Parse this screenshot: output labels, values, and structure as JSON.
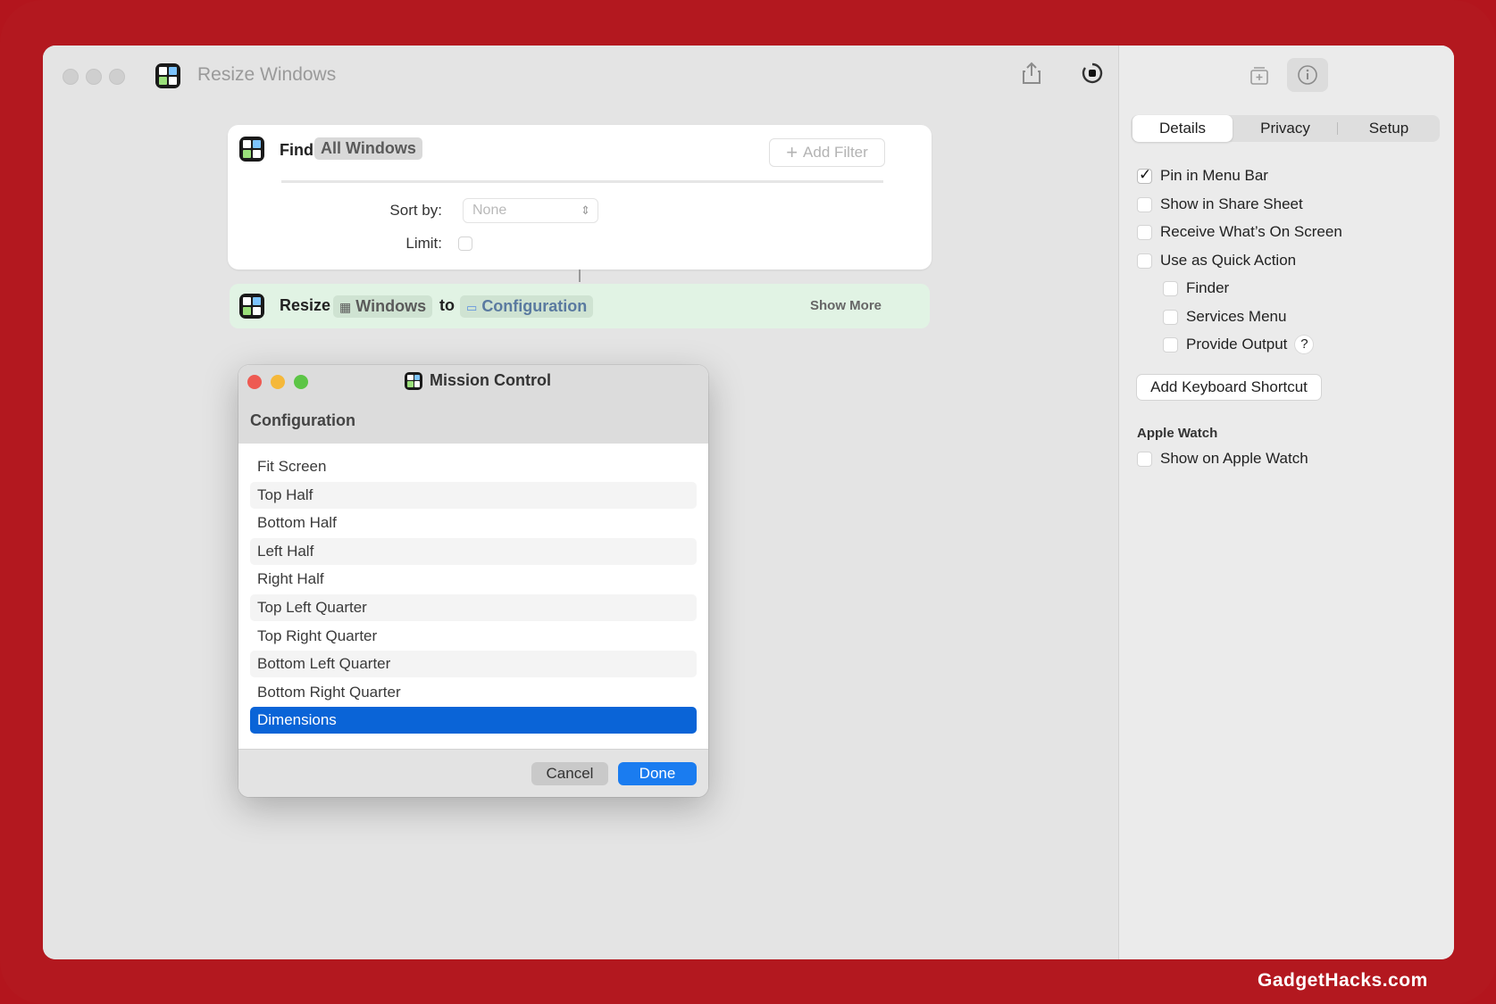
{
  "window": {
    "title": "Resize Windows"
  },
  "find_action": {
    "label": "Find",
    "token": "All Windows",
    "add_filter": "Add Filter",
    "sort_by_label": "Sort by:",
    "sort_by_value": "None",
    "limit_label": "Limit:"
  },
  "resize_action": {
    "label": "Resize",
    "windows_token": "Windows",
    "to_label": "to",
    "config_token": "Configuration",
    "show_more": "Show More"
  },
  "dialog": {
    "title": "Mission Control",
    "subtitle": "Configuration",
    "items": [
      {
        "label": "Fit Screen"
      },
      {
        "label": "Top Half"
      },
      {
        "label": "Bottom Half"
      },
      {
        "label": "Left Half"
      },
      {
        "label": "Right Half"
      },
      {
        "label": "Top Left Quarter"
      },
      {
        "label": "Top Right Quarter"
      },
      {
        "label": "Bottom Left Quarter"
      },
      {
        "label": "Bottom Right Quarter"
      },
      {
        "label": "Dimensions"
      }
    ],
    "selected": "Dimensions",
    "cancel": "Cancel",
    "done": "Done"
  },
  "sidebar": {
    "tabs": [
      "Details",
      "Privacy",
      "Setup"
    ],
    "active_tab": "Details",
    "options": [
      {
        "label": "Pin in Menu Bar",
        "checked": true
      },
      {
        "label": "Show in Share Sheet",
        "checked": false
      },
      {
        "label": "Receive What’s On Screen",
        "checked": false
      },
      {
        "label": "Use as Quick Action",
        "checked": false
      },
      {
        "label": "Finder",
        "checked": false
      },
      {
        "label": "Services Menu",
        "checked": false
      },
      {
        "label": "Provide Output",
        "checked": false
      }
    ],
    "help": "?",
    "keyboard_shortcut": "Add Keyboard Shortcut",
    "apple_watch_section": "Apple Watch",
    "apple_watch_option": "Show on Apple Watch"
  },
  "watermark": "GadgetHacks.com",
  "colors": {
    "frame": "#b3181f",
    "accent": "#1a7cf0",
    "selection": "#0a64d7",
    "resize_card": "#e1f3e4"
  }
}
